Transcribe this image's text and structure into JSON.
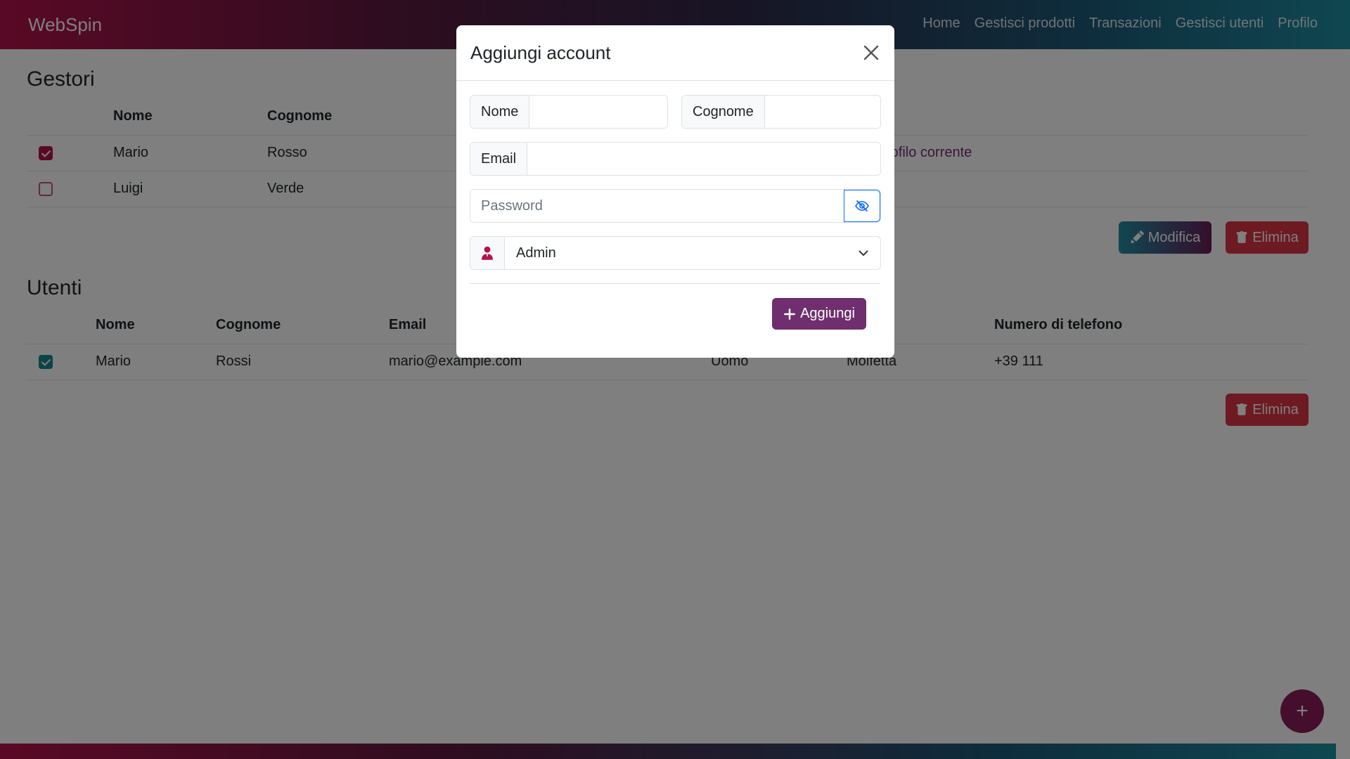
{
  "navbar": {
    "brand": "WebSpin",
    "links": [
      "Home",
      "Gestisci prodotti",
      "Transazioni",
      "Gestisci utenti",
      "Profilo"
    ]
  },
  "gestori": {
    "title": "Gestori",
    "headers": [
      "Nome",
      "Cognome"
    ],
    "rows": [
      {
        "nome": "Mario",
        "cognome": "Rosso",
        "note": "rofilo corrente",
        "checked": true
      },
      {
        "nome": "Luigi",
        "cognome": "Verde",
        "note": "",
        "checked": false
      }
    ],
    "edit_label": "Modifica",
    "delete_label": "Elimina"
  },
  "utenti": {
    "title": "Utenti",
    "headers": [
      "Nome",
      "Cognome",
      "Email",
      "",
      "",
      "Numero di telefono"
    ],
    "rows": [
      {
        "nome": "Mario",
        "cognome": "Rossi",
        "email": "mario@example.com",
        "sesso": "Uomo",
        "citta": "Molfetta",
        "telefono": "+39 111",
        "checked": true
      }
    ],
    "delete_label": "Elimina"
  },
  "modal": {
    "title": "Aggiungi account",
    "nome_label": "Nome",
    "nome_value": "",
    "cognome_label": "Cognome",
    "cognome_value": "",
    "email_label": "Email",
    "email_value": "",
    "password_placeholder": "Password",
    "role_selected": "Admin",
    "submit_label": "Aggiungi"
  },
  "fab_label": "+",
  "colors": {
    "accent_red": "#b3124a",
    "teal": "#17868f",
    "danger": "#dc3545",
    "submit_purple": "#6f2f6e"
  }
}
